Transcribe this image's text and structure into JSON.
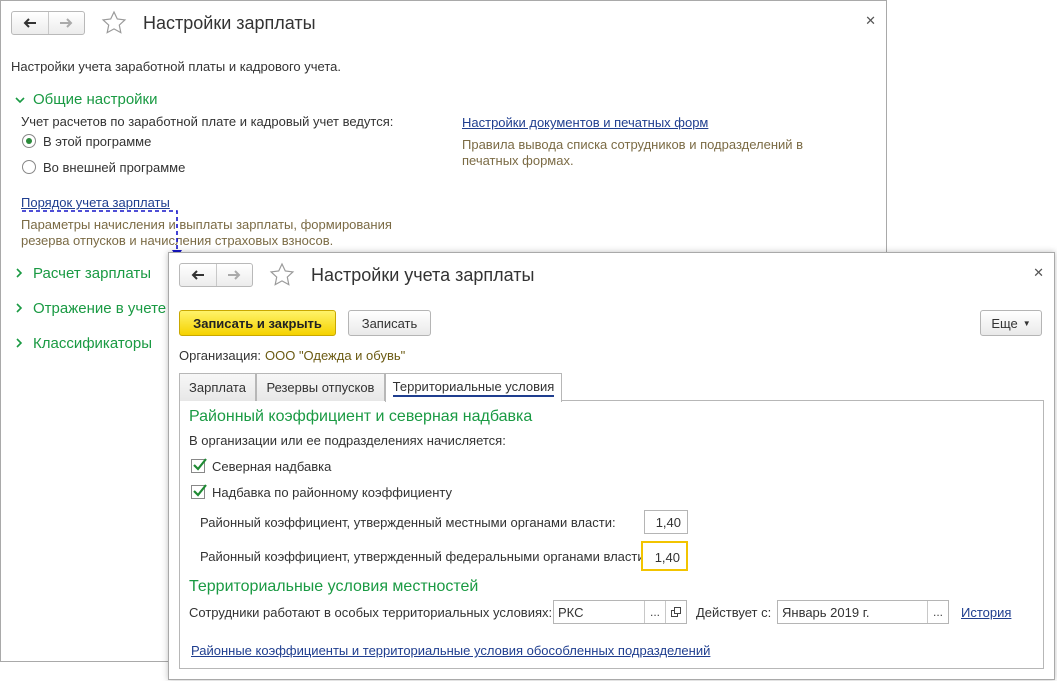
{
  "back_window": {
    "title": "Настройки зарплаты",
    "description": "Настройки учета заработной платы и кадрового учета.",
    "sections": [
      {
        "label": "Общие настройки",
        "expanded": true
      },
      {
        "label": "Расчет зарплаты",
        "expanded": false
      },
      {
        "label": "Отражение в учете",
        "expanded": false
      },
      {
        "label": "Классификаторы",
        "expanded": false
      }
    ],
    "general": {
      "question": "Учет расчетов по заработной плате и кадровый учет ведутся:",
      "options": [
        "В этой программе",
        "Во внешней программе"
      ],
      "selected": 0,
      "order_link": "Порядок учета зарплаты",
      "order_desc_1": "Параметры начисления и выплаты зарплаты, формирования",
      "order_desc_2": "резерва отпусков и начисления страховых взносов.",
      "docs_link": "Настройки документов и печатных форм",
      "docs_desc_1": "Правила вывода списка сотрудников и подразделений в",
      "docs_desc_2": "печатных формах."
    }
  },
  "front_window": {
    "title": "Настройки учета зарплаты",
    "buttons": {
      "save_close": "Записать и закрыть",
      "save": "Записать",
      "more": "Еще"
    },
    "org_label": "Организация:",
    "org_value": "ООО \"Одежда и обувь\"",
    "tabs": [
      "Зарплата",
      "Резервы отпусков",
      "Территориальные условия"
    ],
    "active_tab": 2,
    "regional": {
      "heading": "Районный коэффициент и северная надбавка",
      "subheading": "В организации или ее подразделениях начисляется:",
      "north_bonus": "Северная надбавка",
      "regional_bonus": "Надбавка по районному коэффициенту",
      "local_coef_label": "Районный коэффициент, утвержденный местными органами власти:",
      "local_coef_value": "1,40",
      "federal_coef_label": "Районный коэффициент, утвержденный федеральными органами власти:",
      "federal_coef_value": "1,40"
    },
    "territorial": {
      "heading": "Территориальные условия местностей",
      "employees_label": "Сотрудники работают в особых территориальных условиях:",
      "employees_value": "РКС",
      "valid_from_label": "Действует с:",
      "valid_from_value": "Январь 2019 г.",
      "history_link": "История",
      "bottom_link": "Районные коэффициенты и территориальные условия обособленных подразделений"
    }
  }
}
